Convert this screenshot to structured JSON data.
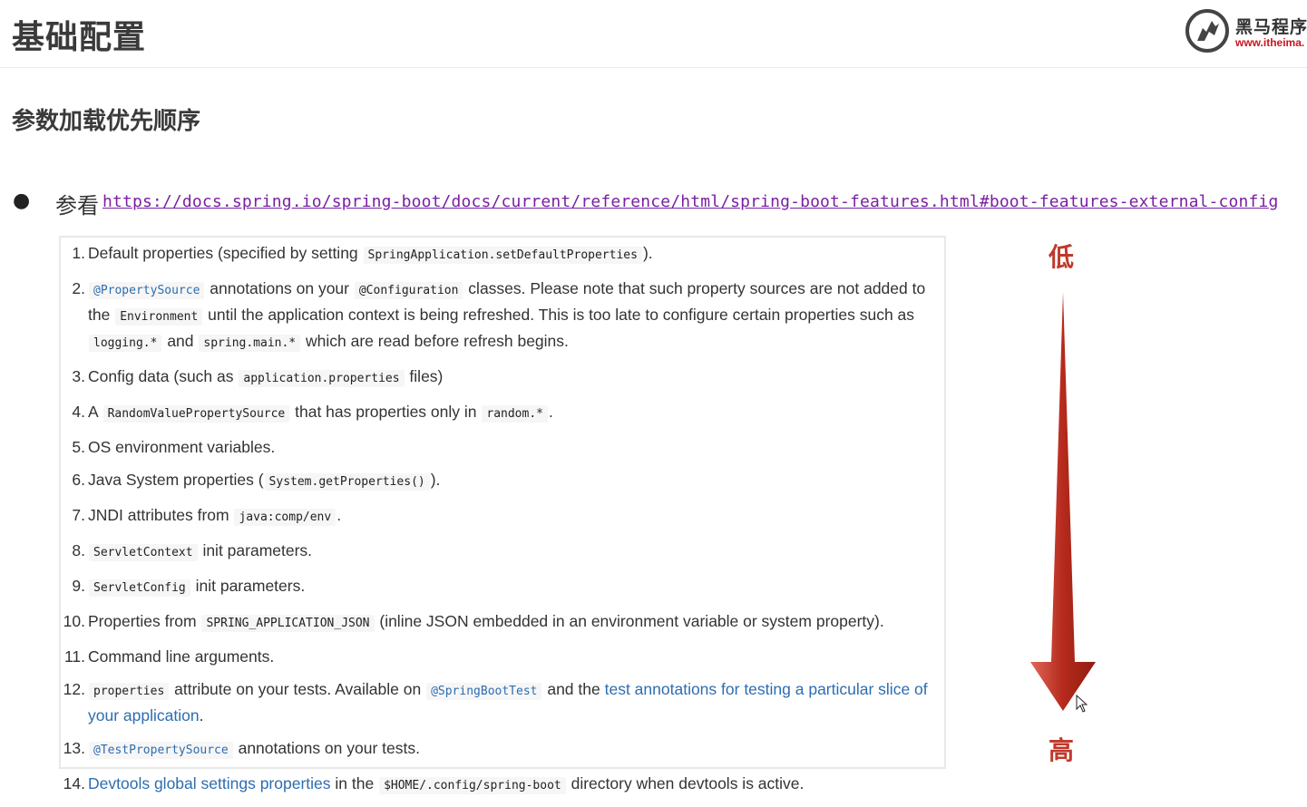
{
  "header": {
    "title": "基础配置",
    "logo_name": "黑马程序",
    "logo_url": "www.itheima."
  },
  "section": {
    "title": "参数加载优先顺序"
  },
  "reference": {
    "label": "参看",
    "url": "https://docs.spring.io/spring-boot/docs/current/reference/html/spring-boot-features.html#boot-features-external-config"
  },
  "list": [
    {
      "num": "1.",
      "parts": [
        {
          "t": "text",
          "v": "Default properties (specified by setting "
        },
        {
          "t": "code",
          "v": "SpringApplication.setDefaultProperties"
        },
        {
          "t": "text",
          "v": ")."
        }
      ]
    },
    {
      "num": "2.",
      "parts": [
        {
          "t": "code-blue",
          "v": "@PropertySource"
        },
        {
          "t": "text",
          "v": " annotations on your "
        },
        {
          "t": "code",
          "v": "@Configuration"
        },
        {
          "t": "text",
          "v": " classes. Please note that such property sources are not added to the "
        },
        {
          "t": "code",
          "v": "Environment"
        },
        {
          "t": "text",
          "v": " until the application context is being refreshed. This is too late to configure certain properties such as "
        },
        {
          "t": "code",
          "v": "logging.*"
        },
        {
          "t": "text",
          "v": " and "
        },
        {
          "t": "code",
          "v": "spring.main.*"
        },
        {
          "t": "text",
          "v": " which are read before refresh begins."
        }
      ]
    },
    {
      "num": "3.",
      "parts": [
        {
          "t": "text",
          "v": "Config data (such as "
        },
        {
          "t": "code",
          "v": "application.properties"
        },
        {
          "t": "text",
          "v": " files)"
        }
      ]
    },
    {
      "num": "4.",
      "parts": [
        {
          "t": "text",
          "v": "A "
        },
        {
          "t": "code",
          "v": "RandomValuePropertySource"
        },
        {
          "t": "text",
          "v": " that has properties only in "
        },
        {
          "t": "code",
          "v": "random.*"
        },
        {
          "t": "text",
          "v": "."
        }
      ]
    },
    {
      "num": "5.",
      "parts": [
        {
          "t": "text",
          "v": "OS environment variables."
        }
      ]
    },
    {
      "num": "6.",
      "parts": [
        {
          "t": "text",
          "v": "Java System properties ("
        },
        {
          "t": "code",
          "v": "System.getProperties()"
        },
        {
          "t": "text",
          "v": ")."
        }
      ]
    },
    {
      "num": "7.",
      "parts": [
        {
          "t": "text",
          "v": "JNDI attributes from "
        },
        {
          "t": "code",
          "v": "java:comp/env"
        },
        {
          "t": "text",
          "v": "."
        }
      ]
    },
    {
      "num": "8.",
      "parts": [
        {
          "t": "code",
          "v": "ServletContext"
        },
        {
          "t": "text",
          "v": " init parameters."
        }
      ]
    },
    {
      "num": "9.",
      "parts": [
        {
          "t": "code",
          "v": "ServletConfig"
        },
        {
          "t": "text",
          "v": " init parameters."
        }
      ]
    },
    {
      "num": "10.",
      "parts": [
        {
          "t": "text",
          "v": "Properties from "
        },
        {
          "t": "code",
          "v": "SPRING_APPLICATION_JSON"
        },
        {
          "t": "text",
          "v": " (inline JSON embedded in an environment variable or system property)."
        }
      ]
    },
    {
      "num": "11.",
      "parts": [
        {
          "t": "text",
          "v": "Command line arguments."
        }
      ]
    },
    {
      "num": "12.",
      "parts": [
        {
          "t": "code",
          "v": "properties"
        },
        {
          "t": "text",
          "v": " attribute on your tests. Available on "
        },
        {
          "t": "code-blue",
          "v": "@SpringBootTest"
        },
        {
          "t": "text",
          "v": " and the "
        },
        {
          "t": "link",
          "v": "test annotations for testing a particular slice of your application"
        },
        {
          "t": "text",
          "v": "."
        }
      ]
    },
    {
      "num": "13.",
      "parts": [
        {
          "t": "code-blue",
          "v": "@TestPropertySource"
        },
        {
          "t": "text",
          "v": " annotations on your tests."
        }
      ]
    },
    {
      "num": "14.",
      "parts": [
        {
          "t": "link",
          "v": "Devtools global settings properties"
        },
        {
          "t": "text",
          "v": " in the "
        },
        {
          "t": "code",
          "v": "$HOME/.config/spring-boot"
        },
        {
          "t": "text",
          "v": " directory when devtools is active."
        }
      ]
    }
  ],
  "priority": {
    "low": "低",
    "high": "高"
  },
  "colors": {
    "arrow": "#c0392b",
    "link_visited": "#7b1fa2",
    "link": "#2d6db0",
    "logo_accent": "#c8161d"
  }
}
